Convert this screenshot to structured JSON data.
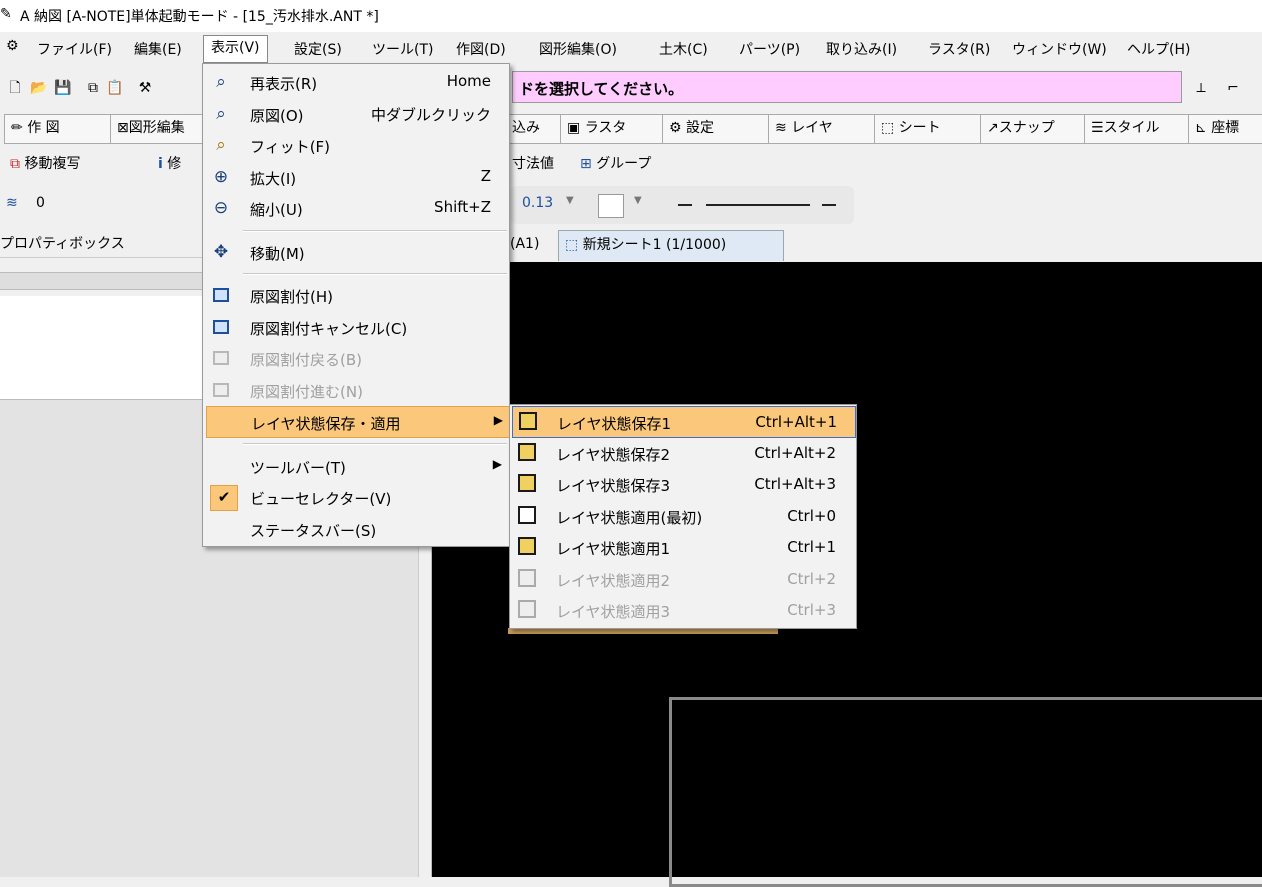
{
  "window": {
    "title": "A 納図 [A-NOTE]単体起動モード - [15_汚水排水.ANT *]"
  },
  "menubar": {
    "items": [
      "ファイル(F)",
      "編集(E)",
      "表示(V)",
      "設定(S)",
      "ツール(T)",
      "作図(D)",
      "図形編集(O)",
      "土木(C)",
      "パーツ(P)",
      "取り込み(I)",
      "ラスタ(R)",
      "ウィンドウ(W)",
      "ヘルプ(H)"
    ]
  },
  "message": "ドを選択してください。",
  "tabs_row": {
    "items": [
      "作 図",
      "図形編集",
      "込み",
      "ラスタ",
      "設定",
      "レイヤ",
      "シート",
      "スナップ",
      "スタイル",
      "座標"
    ]
  },
  "tools_row": {
    "move_copy": "移動複写",
    "modify": "修",
    "dim_value": "寸法値",
    "group": "グループ"
  },
  "layer_value": "0",
  "line_width": "0.13",
  "property_box": "プロパティボックス",
  "sheet_tabs": {
    "prev": "(A1)",
    "current": "新規シート1 (1/1000)"
  },
  "view_menu": {
    "items": [
      {
        "label": "再表示(R)",
        "shortcut": "Home",
        "icon": "zoom-refresh-icon"
      },
      {
        "label": "原図(O)",
        "shortcut": "中ダブルクリック",
        "icon": "zoom-original-icon"
      },
      {
        "label": "フィット(F)",
        "shortcut": "",
        "icon": "zoom-fit-icon"
      },
      {
        "label": "拡大(I)",
        "shortcut": "Z",
        "icon": "zoom-in-icon"
      },
      {
        "label": "縮小(U)",
        "shortcut": "Shift+Z",
        "icon": "zoom-out-icon"
      },
      {
        "label": "移動(M)",
        "shortcut": "",
        "icon": "pan-icon"
      },
      {
        "label": "原図割付(H)",
        "shortcut": "",
        "icon": "fit-frame-icon"
      },
      {
        "label": "原図割付キャンセル(C)",
        "shortcut": "",
        "icon": "fit-frame-cancel-icon"
      },
      {
        "label": "原図割付戻る(B)",
        "shortcut": "",
        "icon": "fit-back-icon",
        "disabled": true
      },
      {
        "label": "原図割付進む(N)",
        "shortcut": "",
        "icon": "fit-forward-icon",
        "disabled": true
      },
      {
        "label": "レイヤ状態保存・適用",
        "shortcut": "",
        "icon": "",
        "submenu": true
      },
      {
        "label": "ツールバー(T)",
        "shortcut": "",
        "icon": "",
        "submenu": true
      },
      {
        "label": "ビューセレクター(V)",
        "shortcut": "",
        "icon": "check-icon",
        "checked": true
      },
      {
        "label": "ステータスバー(S)",
        "shortcut": "",
        "icon": ""
      }
    ]
  },
  "layer_submenu": {
    "items": [
      {
        "label": "レイヤ状態保存1",
        "shortcut": "Ctrl+Alt+1"
      },
      {
        "label": "レイヤ状態保存2",
        "shortcut": "Ctrl+Alt+2"
      },
      {
        "label": "レイヤ状態保存3",
        "shortcut": "Ctrl+Alt+3"
      },
      {
        "label": "レイヤ状態適用(最初)",
        "shortcut": "Ctrl+0"
      },
      {
        "label": "レイヤ状態適用1",
        "shortcut": "Ctrl+1"
      },
      {
        "label": "レイヤ状態適用2",
        "shortcut": "Ctrl+2",
        "disabled": true
      },
      {
        "label": "レイヤ状態適用3",
        "shortcut": "Ctrl+3",
        "disabled": true
      }
    ]
  },
  "colors": {
    "highlight": "#fbc77a",
    "message_bg": "#ffccff",
    "canvas": "#000000"
  }
}
